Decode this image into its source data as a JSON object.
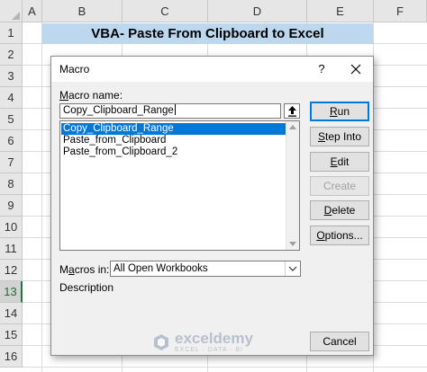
{
  "sheet": {
    "columns": [
      "A",
      "B",
      "C",
      "D",
      "E",
      "F"
    ],
    "rows": [
      "1",
      "2",
      "3",
      "4",
      "5",
      "6",
      "7",
      "8",
      "9",
      "10",
      "11",
      "12",
      "13",
      "14",
      "15",
      "16"
    ],
    "selected_row": "13",
    "banner_text": "VBA- Paste From Clipboard to Excel"
  },
  "dialog": {
    "title": "Macro",
    "help_glyph": "?",
    "macro_name_label": {
      "before": "",
      "underlined": "M",
      "after": "acro name:"
    },
    "macro_name_value": "Copy_Clipboard_Range",
    "macro_list": [
      {
        "label": "Copy_Clipboard_Range",
        "selected": true
      },
      {
        "label": "Paste_from_Clipboard",
        "selected": false
      },
      {
        "label": "Paste_from_Clipboard_2",
        "selected": false
      }
    ],
    "buttons": {
      "run": {
        "before": "",
        "underlined": "R",
        "after": "un"
      },
      "step_into": {
        "before": "",
        "underlined": "S",
        "after": "tep Into"
      },
      "edit": {
        "before": "",
        "underlined": "E",
        "after": "dit"
      },
      "create": {
        "before": "",
        "underlined": "",
        "after": "Create"
      },
      "delete": {
        "before": "",
        "underlined": "D",
        "after": "elete"
      },
      "options": {
        "before": "",
        "underlined": "O",
        "after": "ptions..."
      },
      "cancel": {
        "before": "",
        "underlined": "",
        "after": "Cancel"
      }
    },
    "macros_in_label": {
      "before": "M",
      "underlined": "a",
      "after": "cros in:"
    },
    "macros_in_value": "All Open Workbooks",
    "description_label": "Description"
  },
  "watermark": {
    "name": "exceldemy",
    "tagline": "EXCEL · DATA · BI"
  },
  "colors": {
    "banner_fill": "#bdd7ee",
    "selection": "#0078d7",
    "header_fill": "#e6e6e6",
    "excel_green": "#217346"
  },
  "icons": {
    "close": "close-icon",
    "upload": "upload-arrow-icon",
    "dropdown": "chevron-down-icon",
    "scroll_up": "scroll-up-arrow-icon",
    "scroll_down": "scroll-down-arrow-icon",
    "logo": "exceldemy-logo-icon",
    "corner": "select-all-triangle-icon"
  }
}
